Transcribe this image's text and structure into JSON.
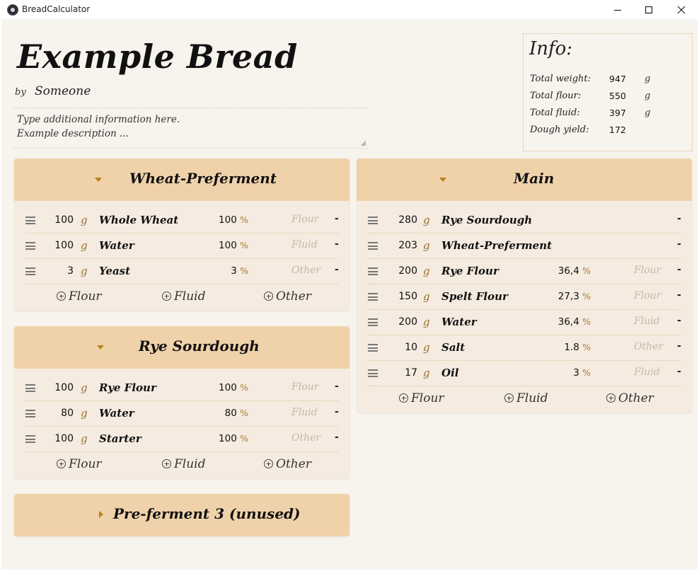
{
  "window": {
    "title": "BreadCalculator"
  },
  "recipe": {
    "title": "Example Bread",
    "by_label": "by",
    "author": "Someone",
    "description": [
      "Type additional information here.",
      "Example description ..."
    ]
  },
  "info": {
    "title": "Info:",
    "total_weight": {
      "label": "Total weight:",
      "value": "947",
      "unit": "g"
    },
    "total_flour": {
      "label": "Total flour:",
      "value": "550",
      "unit": "g"
    },
    "total_fluid": {
      "label": "Total fluid:",
      "value": "397",
      "unit": "g"
    },
    "dough_yield": {
      "label": "Dough yield:",
      "value": "172"
    }
  },
  "units": {
    "gram": "g",
    "percent": "%",
    "delete": "-"
  },
  "add_buttons": {
    "flour": "Flour",
    "fluid": "Fluid",
    "other": "Other"
  },
  "panels": {
    "wheat": {
      "title": "Wheat-Preferment",
      "rows": [
        {
          "amount": "100",
          "name": "Whole Wheat",
          "percent": "100",
          "kind": "Flour"
        },
        {
          "amount": "100",
          "name": "Water",
          "percent": "100",
          "kind": "Fluid"
        },
        {
          "amount": "3",
          "name": "Yeast",
          "percent": "3",
          "kind": "Other"
        }
      ]
    },
    "rye": {
      "title": "Rye Sourdough",
      "rows": [
        {
          "amount": "100",
          "name": "Rye Flour",
          "percent": "100",
          "kind": "Flour"
        },
        {
          "amount": "80",
          "name": "Water",
          "percent": "80",
          "kind": "Fluid"
        },
        {
          "amount": "100",
          "name": "Starter",
          "percent": "100",
          "kind": "Other"
        }
      ]
    },
    "pre3": {
      "title": "Pre-ferment 3 (unused)"
    },
    "main": {
      "title": "Main",
      "rows": [
        {
          "amount": "280",
          "name": "Rye Sourdough"
        },
        {
          "amount": "203",
          "name": "Wheat-Preferment"
        },
        {
          "amount": "200",
          "name": "Rye Flour",
          "percent": "36,4",
          "kind": "Flour"
        },
        {
          "amount": "150",
          "name": "Spelt Flour",
          "percent": "27,3",
          "kind": "Flour"
        },
        {
          "amount": "200",
          "name": "Water",
          "percent": "36,4",
          "kind": "Fluid"
        },
        {
          "amount": "10",
          "name": "Salt",
          "percent": "1.8",
          "kind": "Other"
        },
        {
          "amount": "17",
          "name": "Oil",
          "percent": "3",
          "kind": "Fluid"
        }
      ]
    }
  }
}
